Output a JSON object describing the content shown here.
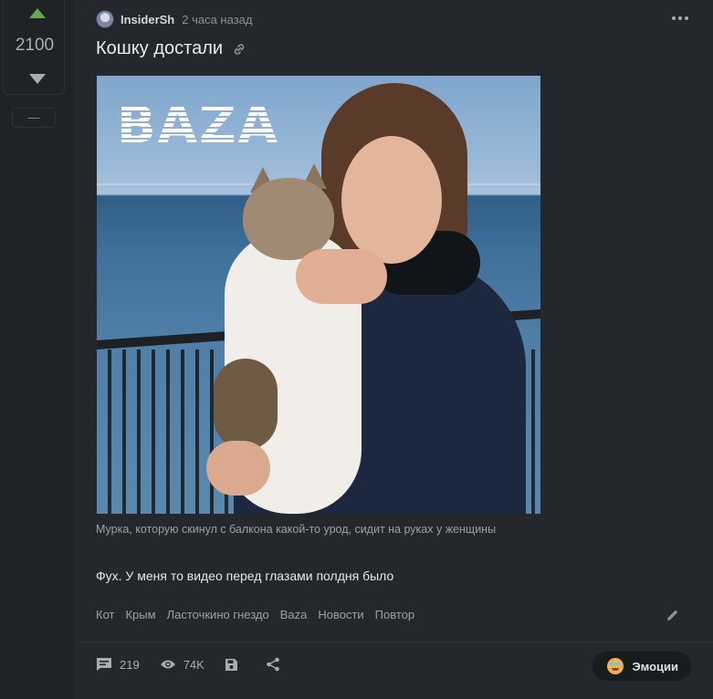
{
  "rating": {
    "value": "2100",
    "minus_label": "—"
  },
  "story": {
    "author": "InsiderSh",
    "time": "2 часа назад",
    "title": "Кошку достали",
    "image_logo": "BAZA",
    "caption": "Мурка, которую скинул с балкона какой-то урод, сидит на руках у женщины",
    "body": "Фух. У меня то видео перед глазами полдня было",
    "tags": [
      "Кот",
      "Крым",
      "Ласточкино гнездо",
      "Baza",
      "Новости",
      "Повтор"
    ]
  },
  "footer": {
    "comments": "219",
    "views": "74K",
    "emotions_label": "Эмоции"
  },
  "colors": {
    "background": "#1f2326",
    "card": "#24282c",
    "upvote": "#6aa84f",
    "muted_text": "#9aa0a6"
  },
  "icons": [
    "vote-up-icon",
    "vote-down-icon",
    "avatar",
    "more-icon",
    "link-icon",
    "edit-icon",
    "comments-icon",
    "views-icon",
    "save-icon",
    "share-icon",
    "emotion-face-icon"
  ]
}
